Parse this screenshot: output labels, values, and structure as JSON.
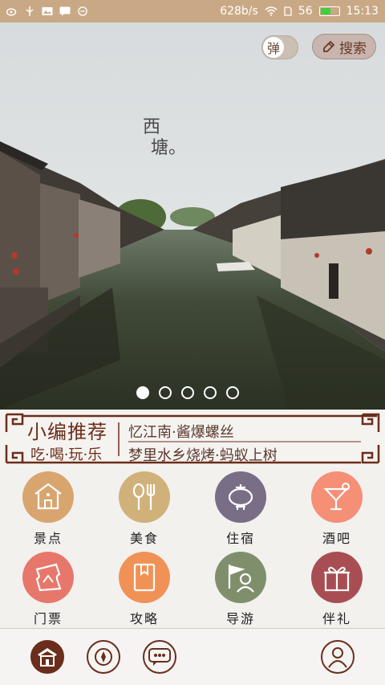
{
  "status_bar": {
    "speed": "628b/s",
    "battery": "56",
    "battery_level": 0.56,
    "time": "15:13",
    "icons": [
      "weibo-icon",
      "usb-icon",
      "image-icon",
      "message-icon",
      "minus-circle-icon",
      "wifi-icon",
      "sim-icon",
      "battery-icon"
    ]
  },
  "hero": {
    "toggle_label": "弹",
    "search_label": "搜索",
    "title_line1": "西",
    "title_line2": "塘。",
    "slides_total": 5,
    "active_slide": 1
  },
  "recommend": {
    "title": "小编推荐",
    "subtitle": "吃·喝·玩·乐",
    "line1": "忆江南·酱爆螺丝",
    "line2": "梦里水乡烧烤·蚂蚁上树",
    "accent": "#6b2d1c"
  },
  "categories": [
    {
      "label": "景点",
      "icon": "pavilion-icon",
      "color": "#d9a56f"
    },
    {
      "label": "美食",
      "icon": "spoon-fork-icon",
      "color": "#d1b17a"
    },
    {
      "label": "住宿",
      "icon": "lantern-icon",
      "color": "#7a6d86"
    },
    {
      "label": "酒吧",
      "icon": "cocktail-icon",
      "color": "#f58f76"
    },
    {
      "label": "门票",
      "icon": "ticket-icon",
      "color": "#e8776b"
    },
    {
      "label": "攻略",
      "icon": "book-icon",
      "color": "#f09256"
    },
    {
      "label": "导游",
      "icon": "guide-icon",
      "color": "#7f8f6c"
    },
    {
      "label": "伴礼",
      "icon": "gift-icon",
      "color": "#a84e52"
    }
  ],
  "bottom_nav": [
    "home-icon",
    "compass-icon",
    "chat-icon",
    "profile-icon"
  ]
}
